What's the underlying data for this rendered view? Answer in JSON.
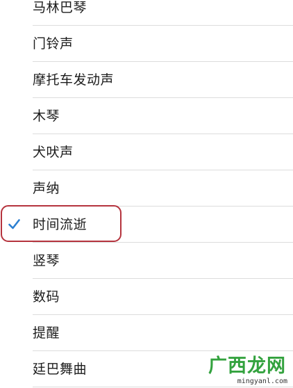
{
  "ringtone_list": {
    "items": [
      {
        "label": "马林巴琴",
        "selected": false
      },
      {
        "label": "门铃声",
        "selected": false
      },
      {
        "label": "摩托车发动声",
        "selected": false
      },
      {
        "label": "木琴",
        "selected": false
      },
      {
        "label": "犬吠声",
        "selected": false
      },
      {
        "label": "声纳",
        "selected": false
      },
      {
        "label": "时间流逝",
        "selected": true
      },
      {
        "label": "竖琴",
        "selected": false
      },
      {
        "label": "数码",
        "selected": false
      },
      {
        "label": "提醒",
        "selected": false
      },
      {
        "label": "廷巴舞曲",
        "selected": false
      }
    ],
    "checkmark_icon": "checkmark-icon",
    "accent_color": "#2b7fd1",
    "highlight_color": "#b5333d"
  },
  "watermark": {
    "title": "广西龙网",
    "url": "mingyanl.com",
    "color": "#33a23e"
  }
}
